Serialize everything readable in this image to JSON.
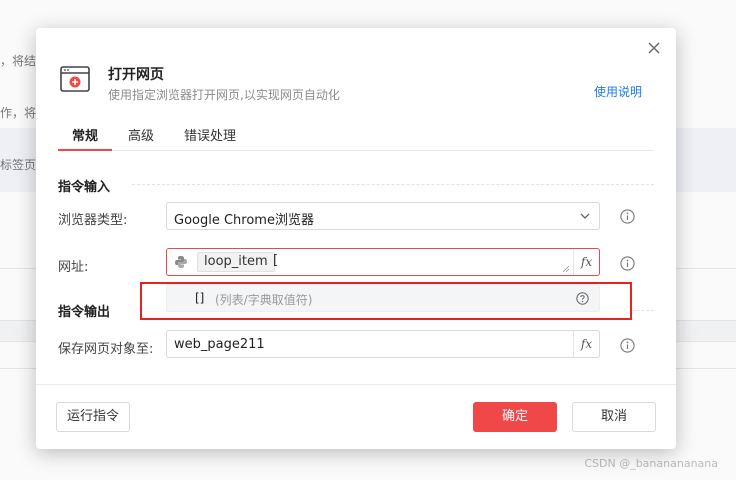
{
  "background": {
    "frag1": "，将结",
    "frag2": "作，将",
    "frag3": "标签页"
  },
  "watermark": "CSDN @_bananananana",
  "dialog": {
    "title": "打开网页",
    "subtitle": "使用指定浏览器打开网页,以实现网页自动化",
    "help_link": "使用说明",
    "tabs": [
      "常规",
      "高级",
      "错误处理"
    ],
    "active_tab": "常规",
    "input_section": "指令输入",
    "output_section": "指令输出",
    "browser_type": {
      "label": "浏览器类型:",
      "value": "Google Chrome浏览器"
    },
    "url": {
      "label": "网址:",
      "chip": "loop_item",
      "typed": "["
    },
    "suggestion": {
      "bracket": "[]",
      "hint": "(列表/字典取值符)"
    },
    "save_object": {
      "label": "保存网页对象至:",
      "value": "web_page211"
    },
    "fx_label": "fx",
    "buttons": {
      "run": "运行指令",
      "ok": "确定",
      "cancel": "取消"
    }
  },
  "colors": {
    "accent": "#f04848",
    "link": "#1e7ae6",
    "highlight_box": "#e32420"
  }
}
